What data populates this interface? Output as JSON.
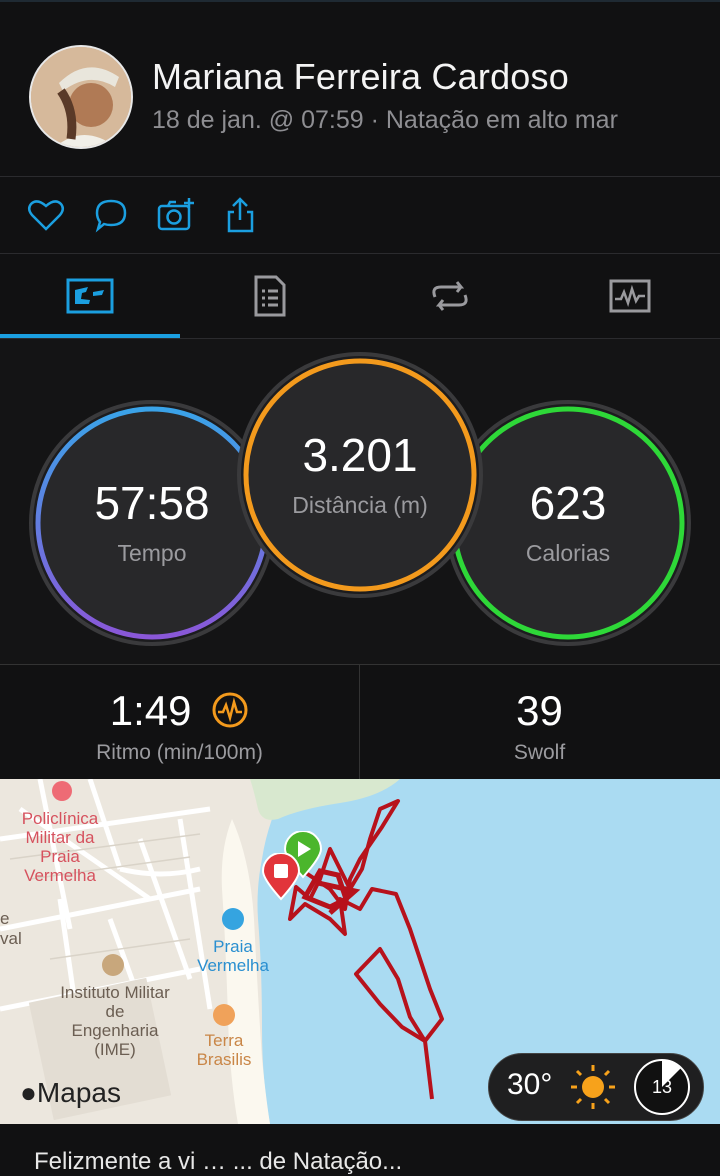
{
  "user": {
    "name": "Mariana Ferreira Cardoso",
    "meta": "18 de jan. @ 07:59 · Natação em alto mar"
  },
  "actions": [
    "heart-icon",
    "comment-icon",
    "add-photo-icon",
    "share-icon"
  ],
  "tabs": [
    "overview-icon",
    "details-icon",
    "laps-icon",
    "charts-icon"
  ],
  "stats": {
    "time": {
      "value": "57:58",
      "label": "Tempo"
    },
    "distance": {
      "value": "3.201",
      "label": "Distância (m)"
    },
    "calories": {
      "value": "623",
      "label": "Calorias"
    }
  },
  "secondary": {
    "pace": {
      "value": "1:49",
      "label": "Ritmo (min/100m)"
    },
    "swolf": {
      "value": "39",
      "label": "Swolf"
    }
  },
  "map": {
    "labels": {
      "policlinica": "Policlínica Militar da Praia Vermelha",
      "praia": "Praia Vermelha",
      "instituto": "Instituto Militar de Engenharia (IME)",
      "terra": "Terra Brasilis",
      "left1": "e",
      "left2": "val"
    },
    "attribution": "Mapas"
  },
  "weather": {
    "temperature": "30°",
    "wind": "13"
  },
  "colors": {
    "accent": "#1b9fe0",
    "time_ring_start": "#3aa3e8",
    "time_ring_end": "#8a57d8",
    "distance_ring": "#f39a1d",
    "calories_ring": "#2ed838",
    "route": "#b7121c"
  },
  "footer": {
    "text": "Felizmente a vi … ... de Natação..."
  }
}
